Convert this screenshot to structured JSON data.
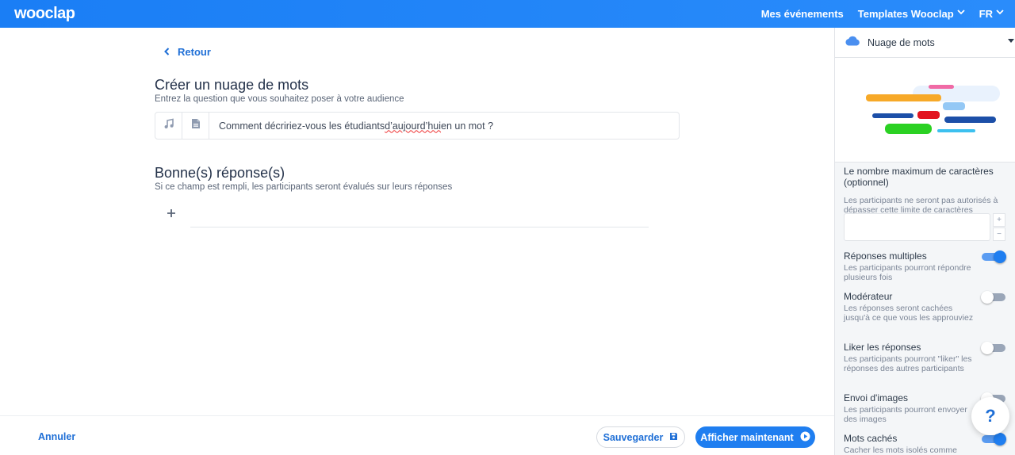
{
  "header": {
    "logo": "wooclap",
    "nav": {
      "events": "Mes événements",
      "templates": "Templates Wooclap",
      "language": "FR"
    }
  },
  "editor": {
    "back_label": "Retour",
    "title": "Créer un nuage de mots",
    "subtitle": "Entrez la question que vous souhaitez poser à votre audience",
    "question": {
      "before": "Comment décririez-vous les étudiants ",
      "misspelled": "d’aujourd’hui",
      "after": " en un mot ?"
    },
    "answers_title": "Bonne(s) réponse(s)",
    "answers_subtitle": "Si ce champ est rempli, les participants seront évalués sur leurs réponses"
  },
  "footer": {
    "cancel": "Annuler",
    "save": "Sauvegarder",
    "show_now": "Afficher maintenant"
  },
  "panel": {
    "type_label": "Nuage de mots",
    "max_chars": {
      "title": "Le nombre maximum de caractères (optionnel)",
      "desc": "Les participants ne seront pas autorisés à dépasser cette limite de caractères",
      "value": ""
    },
    "settings": [
      {
        "title": "Réponses multiples",
        "desc": "Les participants pourront répondre plusieurs fois",
        "enabled": true
      },
      {
        "title": "Modérateur",
        "desc": "Les réponses seront cachées jusqu'à ce que vous les approuviez",
        "enabled": false
      },
      {
        "title": "Liker les réponses",
        "desc": "Les participants pourront \"liker\" les réponses des autres participants",
        "enabled": false
      },
      {
        "title": "Envoi d'images",
        "desc": "Les participants pourront envoyer des images",
        "enabled": false
      },
      {
        "title": "Mots cachés",
        "desc": "Cacher les mots isolés comme",
        "enabled": true
      }
    ]
  },
  "help_label": "?",
  "colors": {
    "brand": "#1f7ef0",
    "link": "#1f6fd6"
  },
  "icons": {
    "back": "chevron-left-icon",
    "audio": "music-note-icon",
    "document": "document-icon",
    "add": "plus-icon",
    "save": "floppy-disk-icon",
    "play": "play-circle-icon",
    "cloud": "cloud-icon",
    "help": "question-icon"
  }
}
